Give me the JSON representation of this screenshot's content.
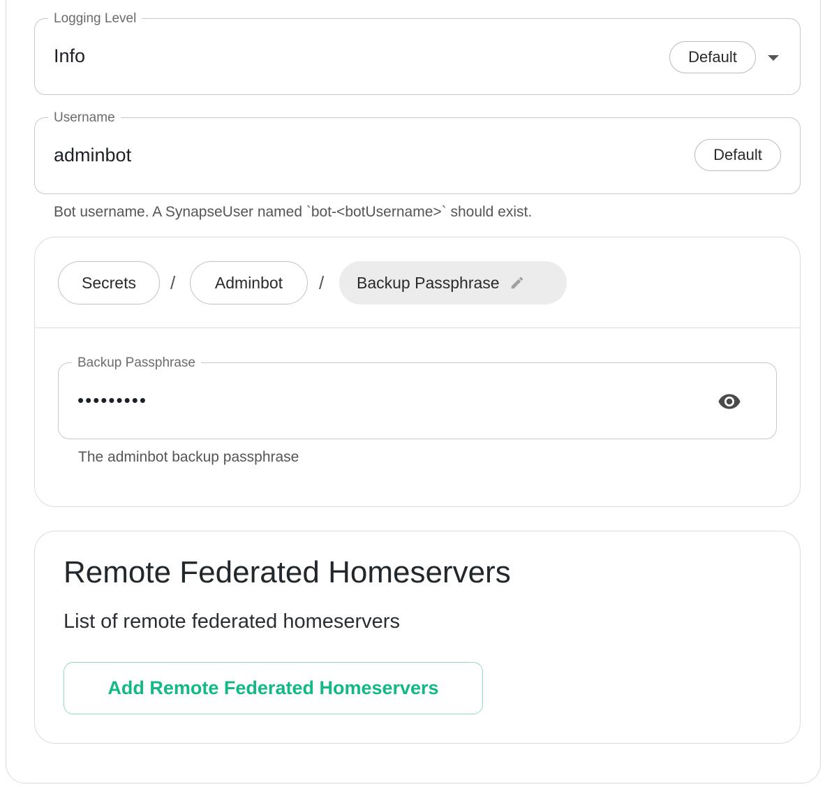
{
  "logging_level": {
    "label": "Logging Level",
    "value": "Info",
    "default_chip": "Default"
  },
  "username": {
    "label": "Username",
    "value": "adminbot",
    "default_chip": "Default",
    "helper": "Bot username. A SynapseUser named `bot-<botUsername>` should exist."
  },
  "secret_card": {
    "breadcrumbs": [
      {
        "label": "Secrets"
      },
      {
        "label": "Adminbot"
      },
      {
        "label": "Backup Passphrase"
      }
    ],
    "separator": "/",
    "passphrase_field": {
      "label": "Backup Passphrase",
      "masked_value": "•••••••••",
      "helper": "The adminbot backup passphrase"
    }
  },
  "federation_card": {
    "title": "Remote Federated Homeservers",
    "description": "List of remote federated homeservers",
    "add_button": "Add Remote Federated Homeservers"
  },
  "colors": {
    "accent_green": "#12b886",
    "border": "#c8c8c8",
    "chip_active_bg": "#ececec"
  }
}
